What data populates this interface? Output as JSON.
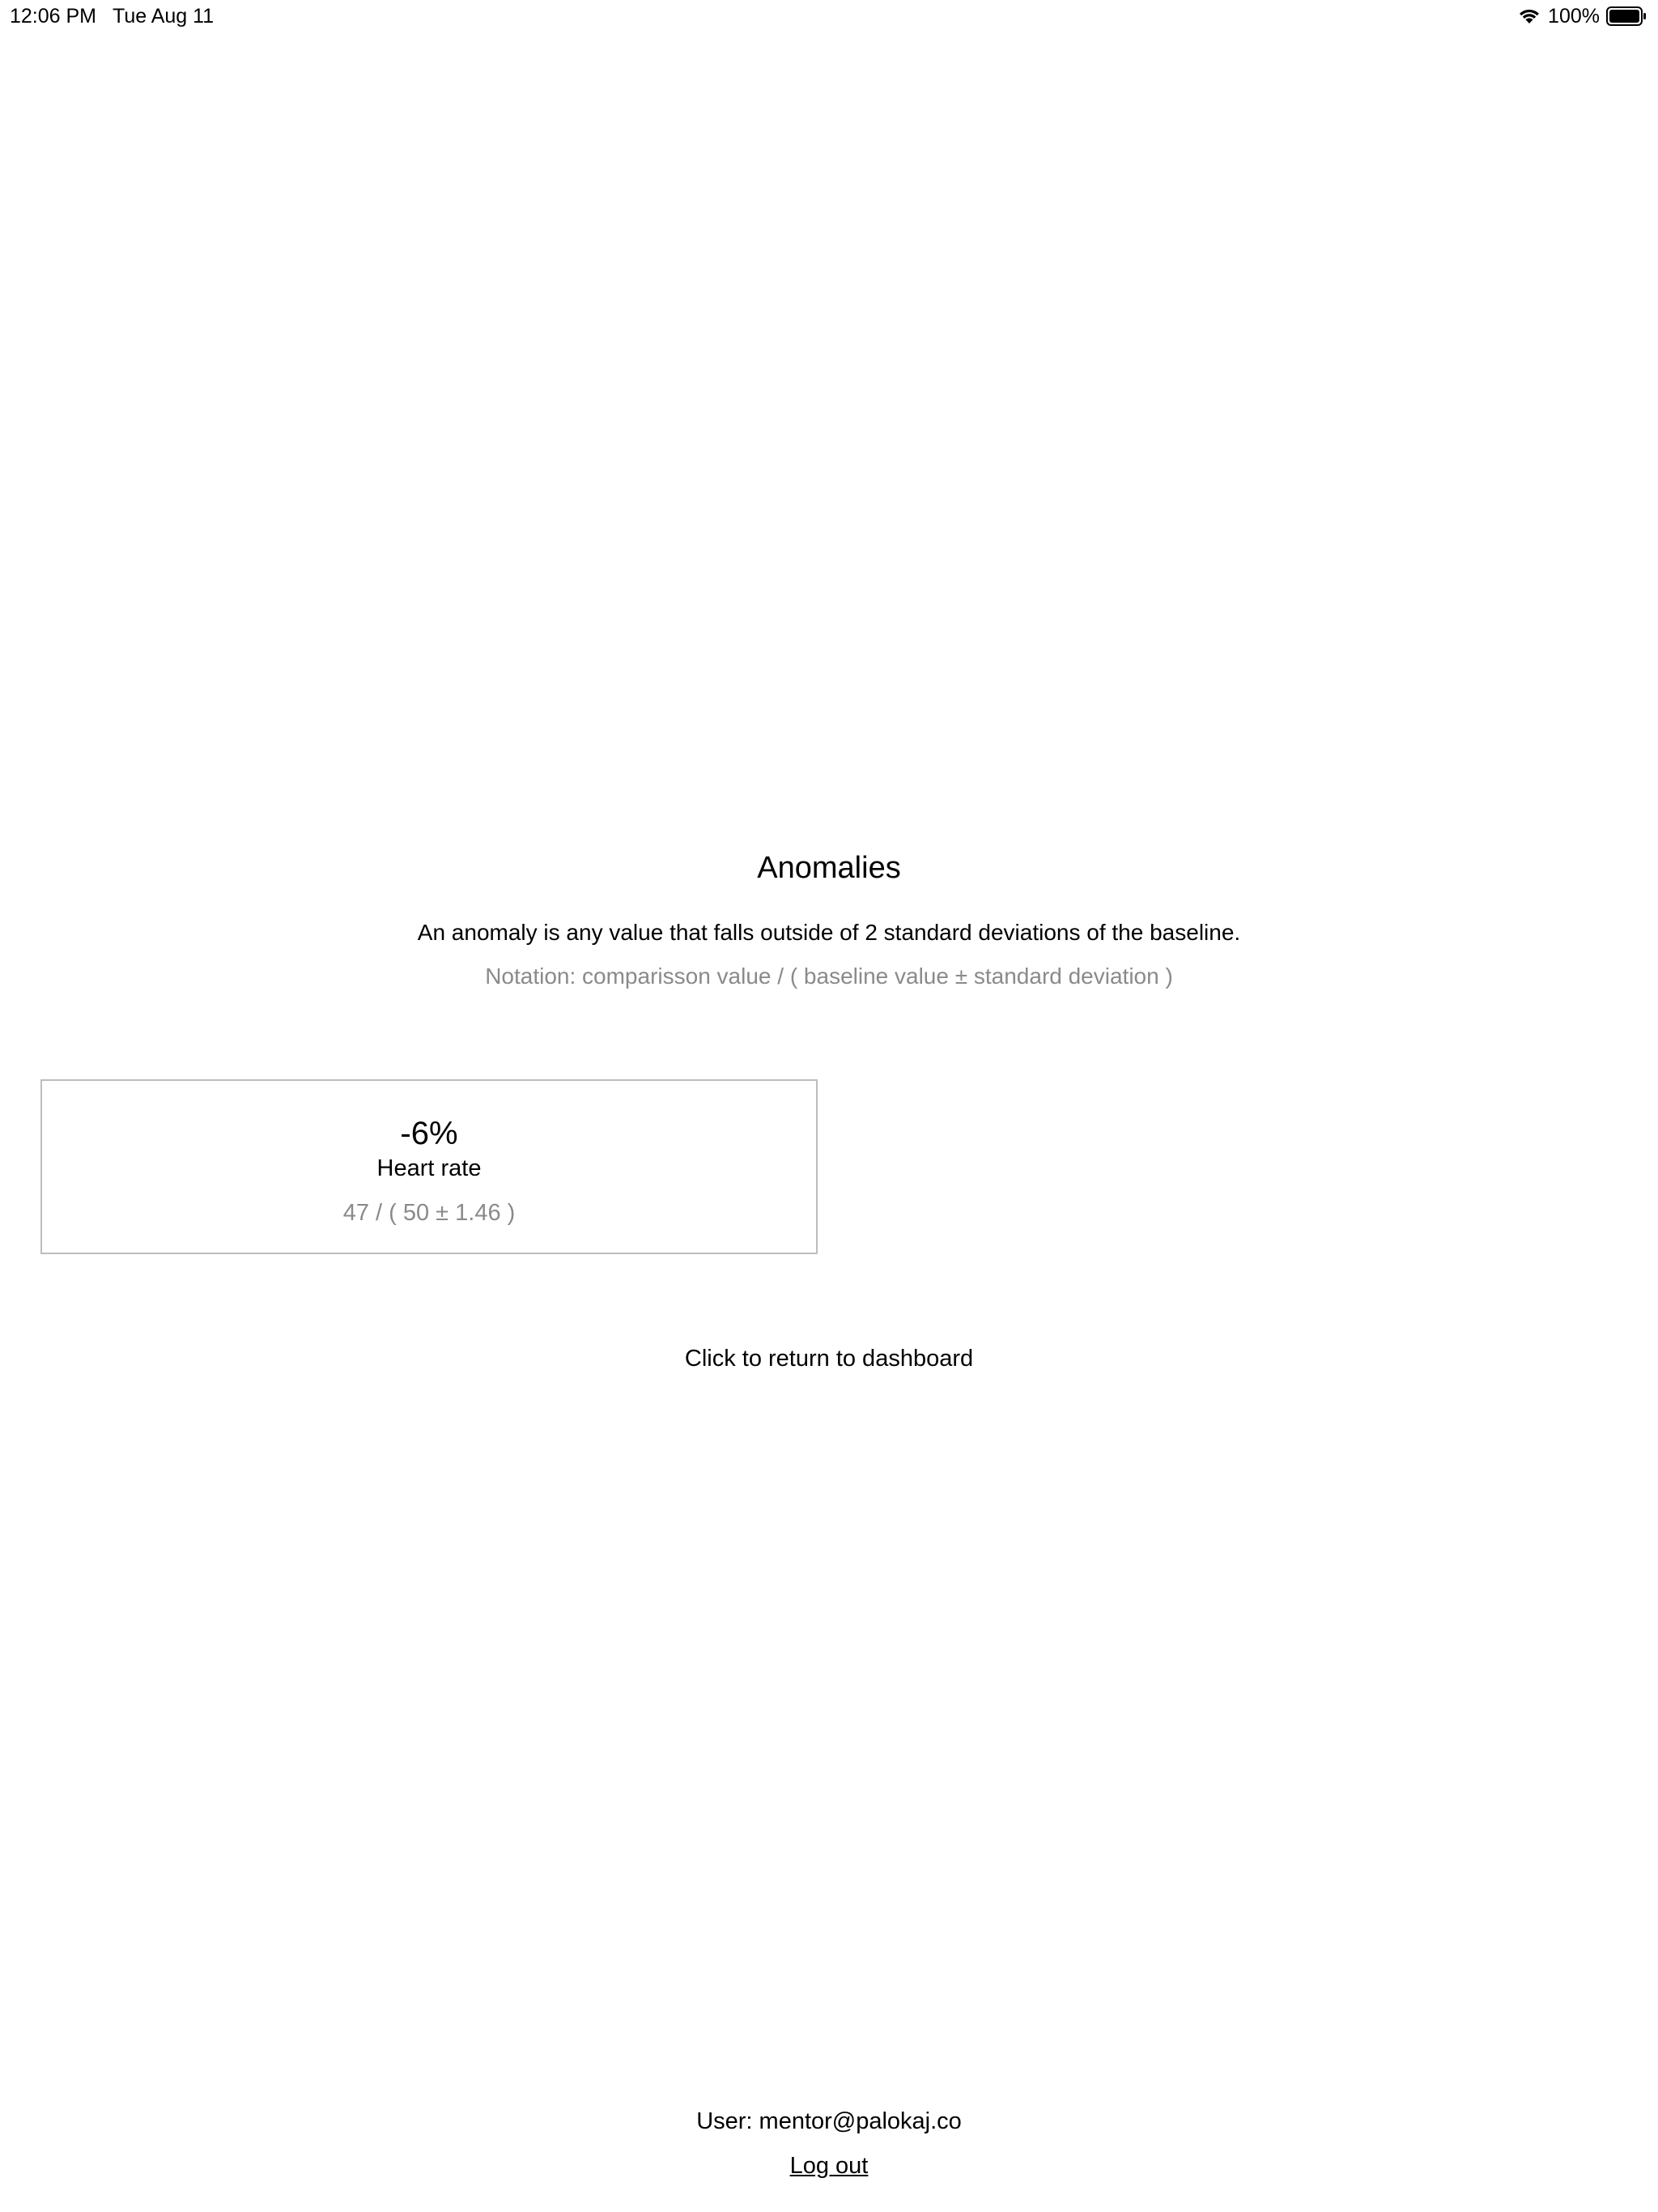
{
  "status_bar": {
    "time": "12:06 PM",
    "date": "Tue Aug 11",
    "battery_percent": "100%",
    "battery_level": 1.0,
    "icons": [
      "wifi-icon",
      "battery-icon"
    ]
  },
  "page": {
    "title": "Anomalies",
    "description": "An anomaly is any value that falls outside of 2 standard deviations of the baseline.",
    "notation": "Notation: comparisson value / ( baseline value ± standard deviation )"
  },
  "anomalies": [
    {
      "percent": "-6%",
      "label": "Heart rate",
      "values": "47 / ( 50 ± 1.46 )"
    }
  ],
  "navigation": {
    "return_label": "Click to return to dashboard"
  },
  "footer": {
    "user_text": "User: mentor@palokaj.co",
    "logout_label": "Log out"
  },
  "colors": {
    "text": "#000000",
    "muted_text": "#8a8a8a",
    "card_border": "#bdbdbd",
    "background": "#ffffff"
  }
}
